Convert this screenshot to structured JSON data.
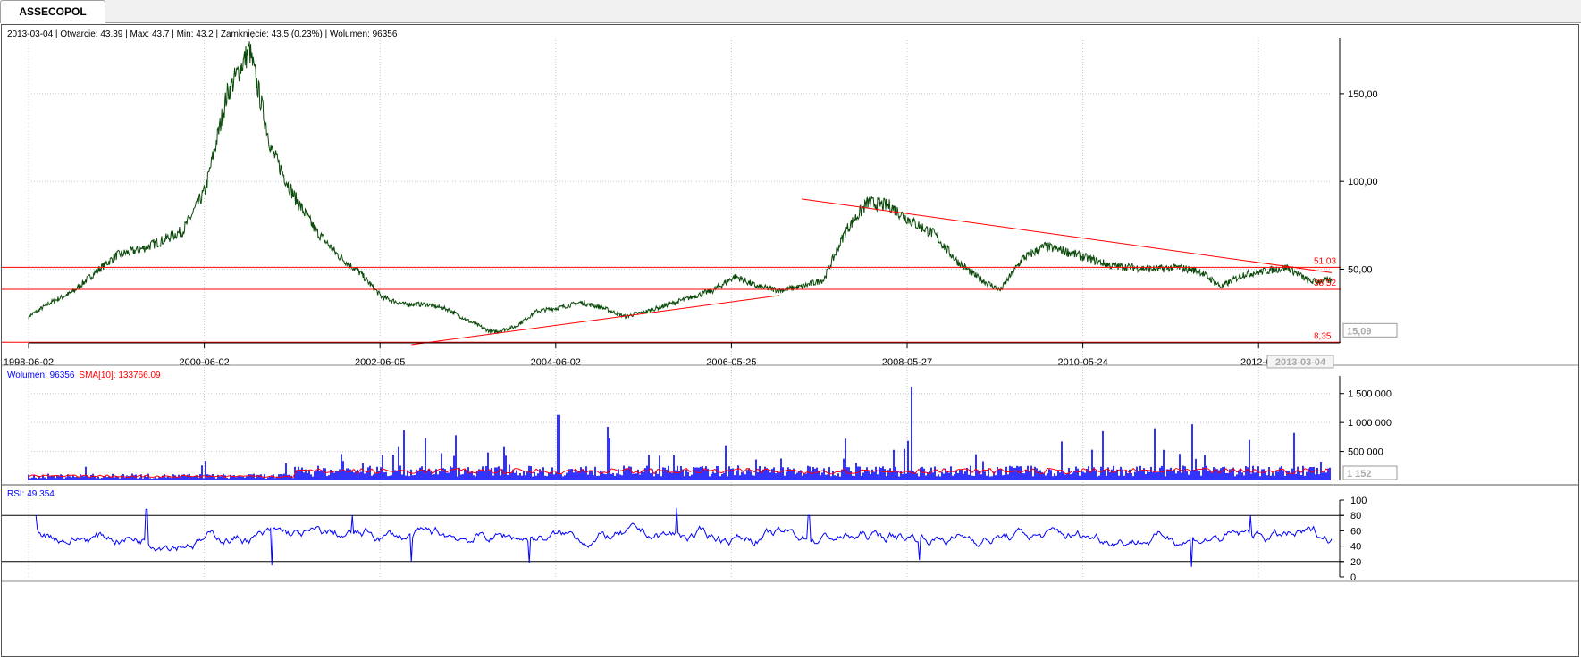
{
  "tab": {
    "label": "ASSECOPOL"
  },
  "header": {
    "date": "2013-03-04",
    "open": "Otwarcie: 43.39",
    "max": "Max: 43.7",
    "min": "Min: 43.2",
    "close": "Zamknięcie: 43.5 (0.23%)",
    "volume": "Wolumen: 96356"
  },
  "colors": {
    "price": "#0a4a0a",
    "volume": "#0000ff",
    "sma": "#ff0000",
    "rsi": "#0000ff",
    "trend": "#ff0000",
    "grid": "#c8c8c8"
  },
  "chart_data": [
    {
      "type": "line",
      "name": "price",
      "x": [
        "1998-06",
        "1998-09",
        "1998-12",
        "1999-03",
        "1999-06",
        "1999-09",
        "1999-12",
        "2000-03",
        "2000-06",
        "2000-09",
        "2000-12",
        "2001-03",
        "2001-06",
        "2001-09",
        "2001-12",
        "2002-03",
        "2002-06",
        "2002-09",
        "2002-12",
        "2003-03",
        "2003-06",
        "2003-09",
        "2003-12",
        "2004-03",
        "2004-06",
        "2004-09",
        "2004-12",
        "2005-03",
        "2005-06",
        "2005-09",
        "2005-12",
        "2006-03",
        "2006-06",
        "2006-09",
        "2006-12",
        "2007-03",
        "2007-06",
        "2007-09",
        "2007-12",
        "2008-03",
        "2008-06",
        "2008-09",
        "2008-12",
        "2009-03",
        "2009-06",
        "2009-09",
        "2009-12",
        "2010-03",
        "2010-06",
        "2010-09",
        "2010-12",
        "2011-03",
        "2011-06",
        "2011-09",
        "2011-12",
        "2012-03",
        "2012-06",
        "2012-09",
        "2012-12",
        "2013-03"
      ],
      "values": [
        23,
        31,
        37,
        48,
        58,
        61,
        66,
        72,
        95,
        150,
        175,
        118,
        92,
        72,
        58,
        48,
        34,
        30,
        30,
        27,
        20,
        14,
        17,
        26,
        28,
        31,
        28,
        23,
        26,
        30,
        34,
        38,
        46,
        40,
        38,
        40,
        44,
        72,
        88,
        86,
        77,
        70,
        55,
        45,
        38,
        56,
        63,
        60,
        56,
        52,
        51,
        50,
        51,
        49,
        40,
        47,
        49,
        51,
        43,
        43.5
      ],
      "ylim": [
        8,
        182
      ],
      "yticks": [
        "50,00",
        "100,00",
        "150,00"
      ],
      "ytick_values": [
        50,
        100,
        150
      ],
      "xticks": [
        "1998-06-02",
        "2000-06-02",
        "2002-06-05",
        "2004-06-02",
        "2006-05-25",
        "2008-05-27",
        "2010-05-24",
        "2012-05"
      ],
      "horizontal_levels": [
        {
          "label": "51,03",
          "value": 51.03
        },
        {
          "label": "38,52",
          "value": 38.52
        },
        {
          "label": "8,35",
          "value": 8.35
        }
      ],
      "trendlines": [
        {
          "from": [
            "2002-10",
            7
          ],
          "to": [
            "2006-12",
            35
          ]
        },
        {
          "from": [
            "2007-03",
            90
          ],
          "to": [
            "2013-03",
            48
          ]
        }
      ],
      "last_value_label": "15,09",
      "cursor_date_label": "2013-03-04"
    },
    {
      "type": "bar",
      "name": "volume",
      "legend": "Wolumen: 96356",
      "sma_legend": "SMA[10]: 133766.09",
      "yticks": [
        "500 000",
        "1 000 000",
        "1 500 000"
      ],
      "ytick_values": [
        500000,
        1000000,
        1500000
      ],
      "ylim": [
        0,
        1650000
      ],
      "last_value_label": "1 152",
      "peaks": [
        {
          "x": "2002-09",
          "value": 870000
        },
        {
          "x": "2003-04",
          "value": 780000
        },
        {
          "x": "2004-06",
          "value": 1130000
        },
        {
          "x": "2007-09",
          "value": 720000
        },
        {
          "x": "2008-06",
          "value": 1620000
        },
        {
          "x": "2010-08",
          "value": 850000
        },
        {
          "x": "2011-08",
          "value": 970000
        },
        {
          "x": "2012-10",
          "value": 820000
        }
      ],
      "typical_level": 170000,
      "sma_level": 160000
    },
    {
      "type": "line",
      "name": "rsi",
      "legend": "RSI: 49.354",
      "yticks": [
        "0",
        "20",
        "40",
        "60",
        "80",
        "100"
      ],
      "ytick_values": [
        0,
        20,
        40,
        60,
        80,
        100
      ],
      "ylim": [
        0,
        100
      ],
      "bands": [
        20,
        80
      ],
      "last_value": 49.354,
      "low_points": [
        {
          "x": "2001-03",
          "value": 15
        },
        {
          "x": "2002-10",
          "value": 20
        },
        {
          "x": "2004-02",
          "value": 18
        },
        {
          "x": "2008-07",
          "value": 22
        },
        {
          "x": "2011-08",
          "value": 13
        }
      ],
      "high_points": [
        {
          "x": "1998-07",
          "value": 80
        },
        {
          "x": "1999-10",
          "value": 88
        },
        {
          "x": "2002-02",
          "value": 80
        },
        {
          "x": "2005-10",
          "value": 90
        },
        {
          "x": "2007-04",
          "value": 80
        },
        {
          "x": "2012-04",
          "value": 80
        }
      ]
    }
  ]
}
